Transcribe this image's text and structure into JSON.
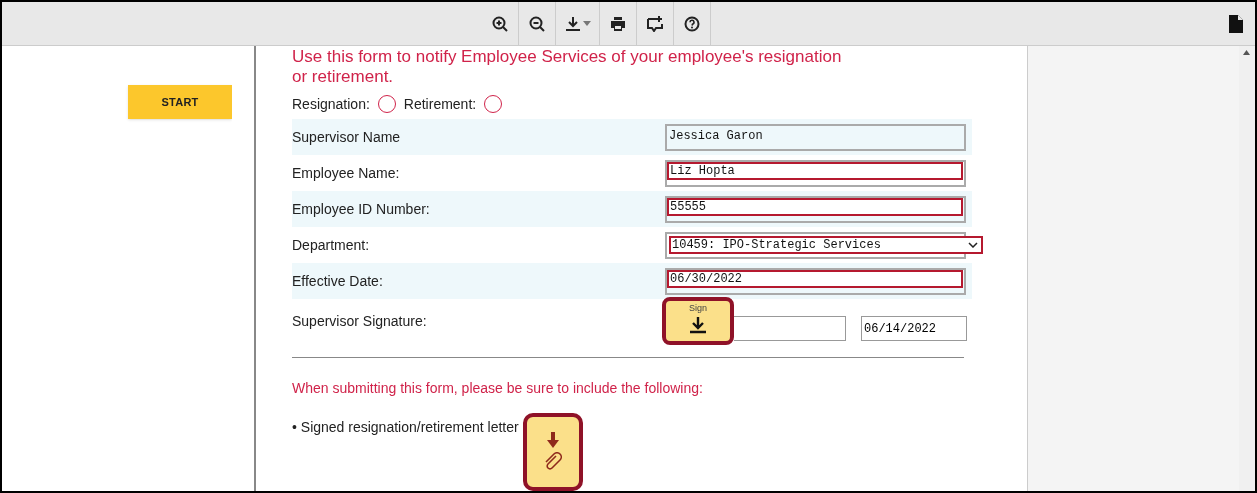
{
  "toolbar": {
    "tools": [
      {
        "kind": "zoom-in"
      },
      {
        "kind": "zoom-out"
      },
      {
        "kind": "download"
      },
      {
        "kind": "print"
      },
      {
        "kind": "comment"
      },
      {
        "kind": "help"
      }
    ]
  },
  "start_button": "START",
  "form": {
    "intro": "Use this form to notify Employee Services of your employee's resignation or retirement.",
    "options": [
      {
        "label": "Resignation:",
        "selected": false
      },
      {
        "label": "Retirement:",
        "selected": false
      }
    ],
    "fields": [
      {
        "label": "Supervisor Name",
        "kind": "text",
        "value": "Jessica Garon",
        "required": false
      },
      {
        "label": "Employee Name:",
        "kind": "text",
        "value": "Liz Hopta",
        "required": true
      },
      {
        "label": "Employee ID Number:",
        "kind": "text",
        "value": "55555",
        "required": true
      },
      {
        "label": "Department:",
        "kind": "select",
        "value": "10459: IPO-Strategic Services",
        "required": true
      },
      {
        "label": "Effective Date:",
        "kind": "text",
        "value": "06/30/2022",
        "required": true
      }
    ],
    "signature": {
      "label": "Supervisor Signature:",
      "sign_button": "Sign",
      "date": "06/14/2022"
    },
    "note": "When submitting this form, please be sure to include the following:",
    "items": [
      "• Signed resignation/retirement letter"
    ]
  }
}
